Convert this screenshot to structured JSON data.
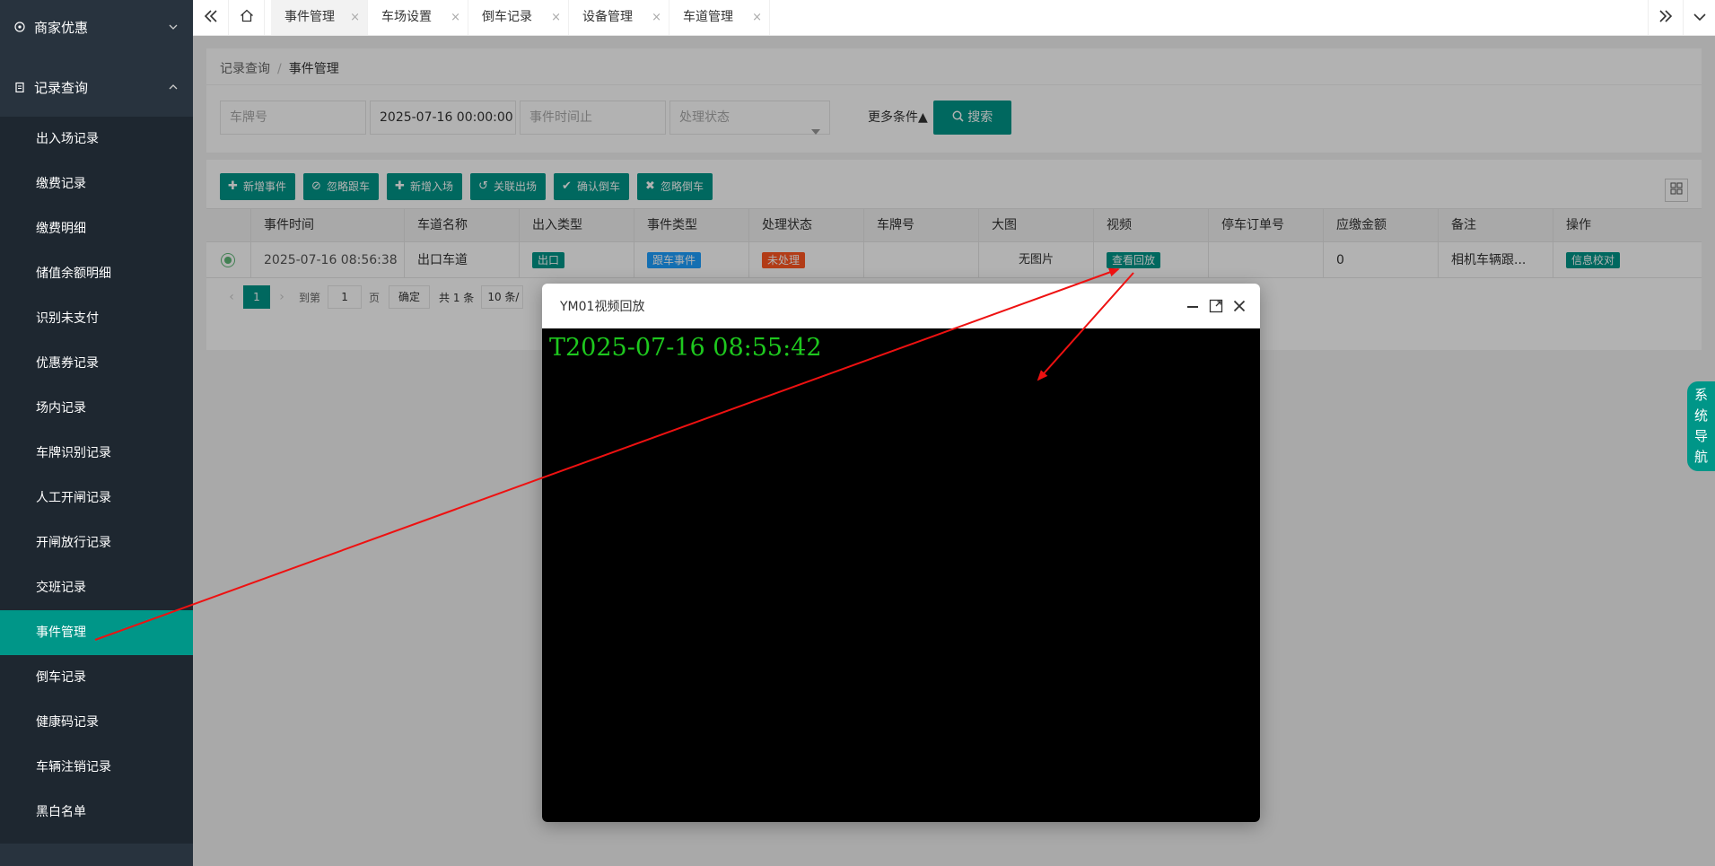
{
  "sidebar": {
    "groups": [
      {
        "label": "商家优惠",
        "icon": "gear-icon",
        "expanded": false
      },
      {
        "label": "记录查询",
        "icon": "clipboard-icon",
        "expanded": true
      }
    ],
    "items": [
      {
        "label": "出入场记录"
      },
      {
        "label": "缴费记录"
      },
      {
        "label": "缴费明细"
      },
      {
        "label": "储值余额明细"
      },
      {
        "label": "识别未支付"
      },
      {
        "label": "优惠券记录"
      },
      {
        "label": "场内记录"
      },
      {
        "label": "车牌识别记录"
      },
      {
        "label": "人工开闸记录"
      },
      {
        "label": "开闸放行记录"
      },
      {
        "label": "交班记录"
      },
      {
        "label": "事件管理",
        "active": true
      },
      {
        "label": "倒车记录"
      },
      {
        "label": "健康码记录"
      },
      {
        "label": "车辆注销记录"
      },
      {
        "label": "黑白名单"
      }
    ]
  },
  "tabs": [
    {
      "label": "事件管理",
      "active": true
    },
    {
      "label": "车场设置"
    },
    {
      "label": "倒车记录"
    },
    {
      "label": "设备管理"
    },
    {
      "label": "车道管理"
    }
  ],
  "tab_close_glyph": "×",
  "breadcrumb": {
    "parent": "记录查询",
    "separator": "/",
    "current": "事件管理"
  },
  "filters": {
    "plate_placeholder": "车牌号",
    "start_time_value": "2025-07-16 00:00:00",
    "end_time_placeholder": "事件时间止",
    "status_placeholder": "处理状态",
    "more_conditions": "更多条件▲",
    "search_label": "搜索"
  },
  "toolbar": {
    "add_event": "新增事件",
    "ignore_tailgate": "忽略跟车",
    "add_entry": "新增入场",
    "link_exit": "关联出场",
    "confirm_reverse": "确认倒车",
    "ignore_reverse": "忽略倒车"
  },
  "table": {
    "columns": [
      "事件时间",
      "车道名称",
      "出入类型",
      "事件类型",
      "处理状态",
      "车牌号",
      "大图",
      "视频",
      "停车订单号",
      "应缴金额",
      "备注",
      "操作"
    ],
    "rows": [
      {
        "selected": true,
        "event_time": "2025-07-16 08:56:38",
        "lane_name": "出口车道",
        "io_type": "出口",
        "event_type": "跟车事件",
        "status": "未处理",
        "plate": "",
        "image": "无图片",
        "video_btn": "查看回放",
        "order_no": "",
        "amount": "0",
        "remark": "相机车辆跟...",
        "action_btn": "信息校对"
      }
    ]
  },
  "pagination": {
    "current_page": "1",
    "goto_label": "到第",
    "goto_value": "1",
    "page_unit": "页",
    "confirm_label": "确定",
    "total_label": "共 1 条",
    "page_size_label": "10 条/"
  },
  "system_nav": [
    "系",
    "统",
    "导",
    "航"
  ],
  "modal": {
    "title": "YM01视频回放",
    "video_timestamp": "T2025-07-16 08:55:42"
  },
  "colors": {
    "primary": "#009688",
    "sidebar_bg": "#28333e",
    "submenu_bg": "#1e2730",
    "tag_blue": "#1E9FFF",
    "tag_orange": "#FF5722",
    "timestamp_green": "#1ec81e",
    "annotation_red": "#ee1111"
  }
}
